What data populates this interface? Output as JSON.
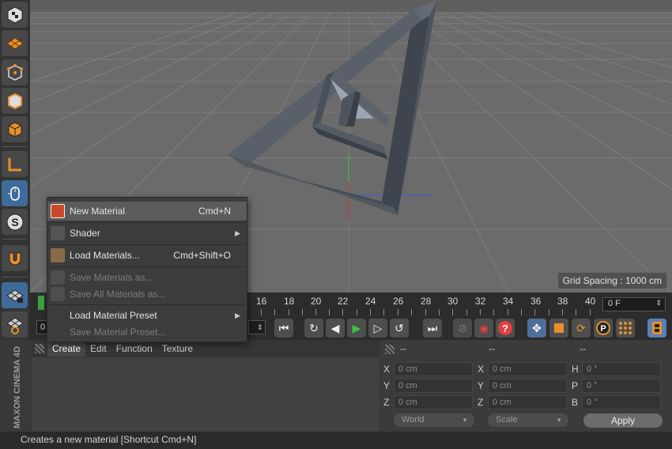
{
  "viewport": {
    "grid_spacing": "Grid Spacing : 1000 cm"
  },
  "timeline": {
    "ticks": [
      "16",
      "18",
      "20",
      "22",
      "24",
      "26",
      "28",
      "30",
      "32",
      "34",
      "36",
      "38",
      "40"
    ],
    "frame": "0 F",
    "left_partial_field": "0"
  },
  "material_manager": {
    "tabs": [
      "Create",
      "Edit",
      "Function",
      "Texture"
    ]
  },
  "context_menu": {
    "new_material": {
      "label": "New Material",
      "shortcut": "Cmd+N"
    },
    "shader": {
      "label": "Shader"
    },
    "load_materials": {
      "label": "Load Materials...",
      "shortcut": "Cmd+Shift+O"
    },
    "save_materials_as": {
      "label": "Save Materials as..."
    },
    "save_all_materials_as": {
      "label": "Save All Materials as..."
    },
    "load_material_preset": {
      "label": "Load Material Preset"
    },
    "save_material_preset": {
      "label": "Save Material Preset..."
    }
  },
  "coordinates": {
    "header": [
      "--",
      "--",
      "--"
    ],
    "rows": [
      [
        {
          "label": "X",
          "value": "0 cm"
        },
        {
          "label": "X",
          "value": "0 cm"
        },
        {
          "label": "H",
          "value": "0 °"
        }
      ],
      [
        {
          "label": "Y",
          "value": "0 cm"
        },
        {
          "label": "Y",
          "value": "0 cm"
        },
        {
          "label": "P",
          "value": "0 °"
        }
      ],
      [
        {
          "label": "Z",
          "value": "0 cm"
        },
        {
          "label": "Z",
          "value": "0 cm"
        },
        {
          "label": "B",
          "value": "0 °"
        }
      ]
    ],
    "mode_select": "World",
    "scale_select": "Scale",
    "apply": "Apply"
  },
  "status": {
    "text": "Creates a new material [Shortcut Cmd+N]"
  },
  "logo": {
    "text": "MAXON CINEMA 4D"
  },
  "colors": {
    "accent_blue": "#5682b6",
    "orange": "#e8902a",
    "highlight": "#5b5b5b"
  }
}
